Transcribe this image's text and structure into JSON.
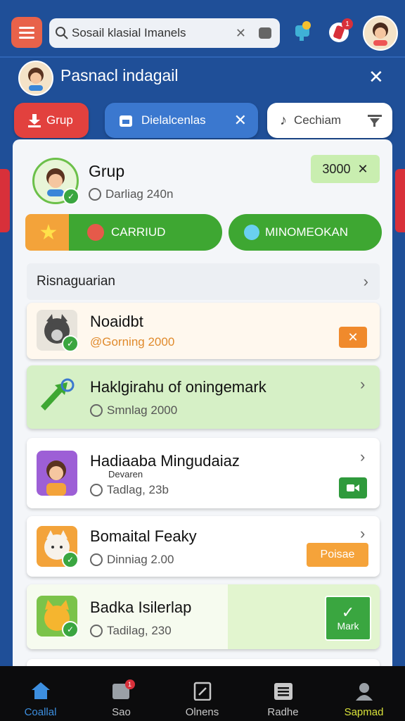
{
  "search": {
    "value": "Sosail klasial Imanels"
  },
  "notifications": {
    "badge": "1"
  },
  "header": {
    "title": "Pasnacl indagail"
  },
  "chips": {
    "grup": "Grup",
    "detail": "Dielalcenlas",
    "cechiam": "Cechiam"
  },
  "group": {
    "name": "Grup",
    "sub": "Darliag 240n",
    "amount": "3000"
  },
  "actions": {
    "carriud": "CARRIUD",
    "minomeokan": "MINOMEOKAN"
  },
  "section": {
    "label": "Risnaguarian"
  },
  "items": [
    {
      "title": "Noaidbt",
      "sub": "@Gorning 2000",
      "accent": "#f08a2c"
    },
    {
      "title": "Haklgirahu of oningemark",
      "sub": "Smnlag 2000",
      "accent": "#d8f2c9"
    },
    {
      "title": "Hadiaaba Mingudaiaz",
      "note": "Devaren",
      "sub": "Tadlag, 23b",
      "accent": "#2f9a3c"
    },
    {
      "title": "Bomaital Feaky",
      "sub": "Dinniag 2.00",
      "button": "Poisae",
      "accent": "#f5a33a"
    },
    {
      "title": "Badka Isilerlap",
      "sub": "Tadilag, 230",
      "button": "Mark",
      "accent": "#3aa640"
    }
  ],
  "nav": [
    {
      "label": "Coallal",
      "active": true
    },
    {
      "label": "Sao",
      "badge": "1"
    },
    {
      "label": "Olnens"
    },
    {
      "label": "Radhe"
    },
    {
      "label": "Sapmad"
    }
  ]
}
